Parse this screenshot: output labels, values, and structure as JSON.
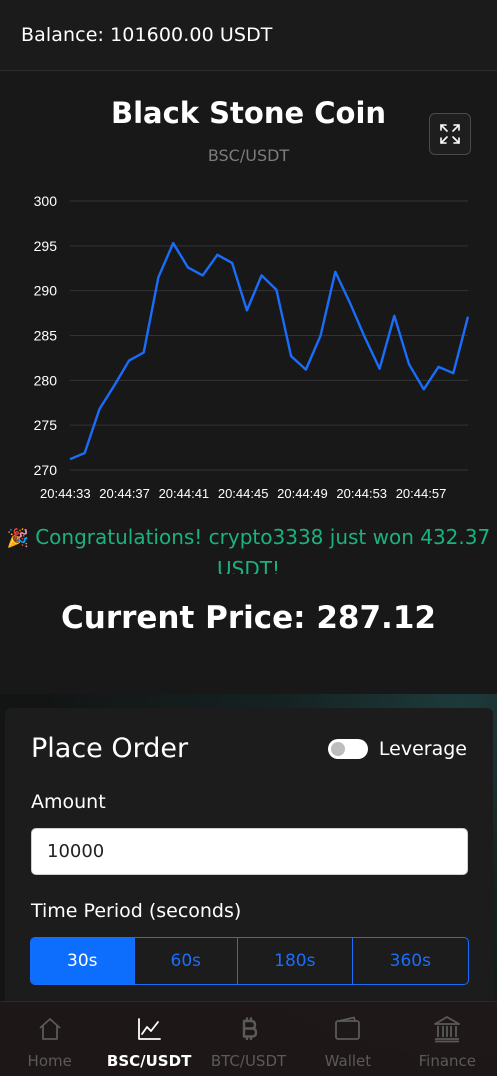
{
  "header": {
    "balance": "Balance: 101600.00 USDT"
  },
  "coin": {
    "name": "Black Stone Coin",
    "pair": "BSC/USDT"
  },
  "chart_data": {
    "type": "line",
    "ylim": [
      270,
      300
    ],
    "y_ticks": [
      "300",
      "295",
      "290",
      "285",
      "280",
      "275",
      "270"
    ],
    "x_tick_labels": [
      "20:44:33",
      "20:44:37",
      "20:44:41",
      "20:44:45",
      "20:44:49",
      "20:44:53",
      "20:44:57"
    ],
    "grid": true,
    "line_color": "#1a6dfb",
    "values": [
      271.2,
      271.9,
      276.8,
      279.4,
      282.2,
      283.1,
      291.5,
      295.3,
      292.6,
      291.7,
      294.0,
      293.1,
      287.8,
      291.7,
      290.1,
      282.7,
      281.2,
      285.0,
      292.1,
      288.6,
      284.8,
      281.3,
      287.2,
      281.8,
      279.0,
      281.5,
      280.8,
      287.1
    ]
  },
  "notification": {
    "icon": "party-popper-icon",
    "text": "Congratulations! crypto3338 just won 432.37 USDT!"
  },
  "current_price": "Current Price: 287.12",
  "order": {
    "title": "Place Order",
    "leverage_label": "Leverage",
    "amount_label": "Amount",
    "amount_value": "10000",
    "period_label": "Time Period (seconds)",
    "periods": [
      "30s",
      "60s",
      "180s",
      "360s"
    ],
    "active_period": "30s"
  },
  "nav": {
    "items": [
      {
        "label": "Home",
        "icon": "home-icon"
      },
      {
        "label": "BSC/USDT",
        "icon": "chart-line-icon"
      },
      {
        "label": "BTC/USDT",
        "icon": "bitcoin-icon"
      },
      {
        "label": "Wallet",
        "icon": "wallet-icon"
      },
      {
        "label": "Finance",
        "icon": "bank-icon"
      }
    ],
    "active": "BSC/USDT"
  },
  "colors": {
    "accent": "#0d6efd",
    "success": "#19b37d",
    "background": "#181818"
  }
}
